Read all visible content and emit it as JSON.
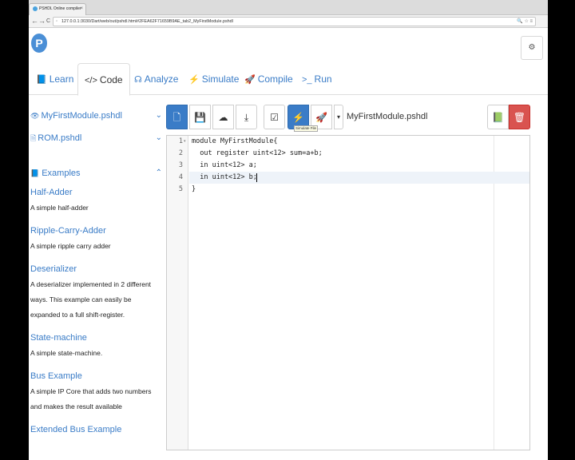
{
  "browser": {
    "tab_title": "PSHDL Online compiler",
    "tab_close": "×",
    "back": "←",
    "forward": "→",
    "reload": "C",
    "url": "127.0.0.1:3030/Dart/web/out/pshdl.html#2FEA62F71659B9AE_tab2_MyFirstModule.pshdl",
    "url_icons": "🔍 ☆ ≡"
  },
  "app": {
    "logo": "P",
    "user_icon": "⚙"
  },
  "main_tabs": [
    {
      "icon": "📘",
      "label": "Learn"
    },
    {
      "icon": "</>",
      "label": "Code"
    },
    {
      "icon": "☊",
      "label": "Analyze"
    },
    {
      "icon": "⚡",
      "label": "Simulate"
    },
    {
      "icon": "🚀",
      "label": "Compile"
    },
    {
      "icon": ">_",
      "label": "Run"
    }
  ],
  "sidebar": {
    "files": [
      {
        "icon": "👁",
        "label": "MyFirstModule.pshdl",
        "chevron": "⌄"
      },
      {
        "icon": "🗎",
        "label": "ROM.pshdl",
        "chevron": "⌄"
      }
    ],
    "examples_header": {
      "icon": "📘",
      "label": "Examples",
      "chevron": "⌃"
    },
    "examples": [
      {
        "title": "Half-Adder",
        "desc": "A simple half-adder"
      },
      {
        "title": "Ripple-Carry-Adder",
        "desc": "A simple ripple carry adder"
      },
      {
        "title": "Deserializer",
        "desc": "A deserializer implemented in 2 different ways. This example can easily be expanded to a full shift-register."
      },
      {
        "title": "State-machine",
        "desc": "A simple state-machine."
      },
      {
        "title": "Bus Example",
        "desc": "A simple IP Core that adds two numbers and makes the result available"
      },
      {
        "title": "Extended Bus Example",
        "desc": ""
      }
    ]
  },
  "toolbar": {
    "new_icon": "🗋",
    "save_icon": "💾",
    "upload_icon": "☁",
    "download_icon": "⤓",
    "check_icon": "☑",
    "simulate_icon": "⚡",
    "simulate_tooltip": "Simulate File",
    "compile_icon": "🚀",
    "dropdown_icon": "▾",
    "file_name": "MyFirstModule.pshdl",
    "docs_icon": "📗",
    "delete_icon": "🗑"
  },
  "editor": {
    "fold_marker": "▾",
    "lines": [
      {
        "num": "1",
        "text": "module MyFirstModule{"
      },
      {
        "num": "2",
        "text": "  out register uint<12> sum=a+b;"
      },
      {
        "num": "3",
        "text": "  in uint<12> a;"
      },
      {
        "num": "4",
        "text": "  in uint<12> b;"
      },
      {
        "num": "5",
        "text": "}"
      }
    ]
  }
}
